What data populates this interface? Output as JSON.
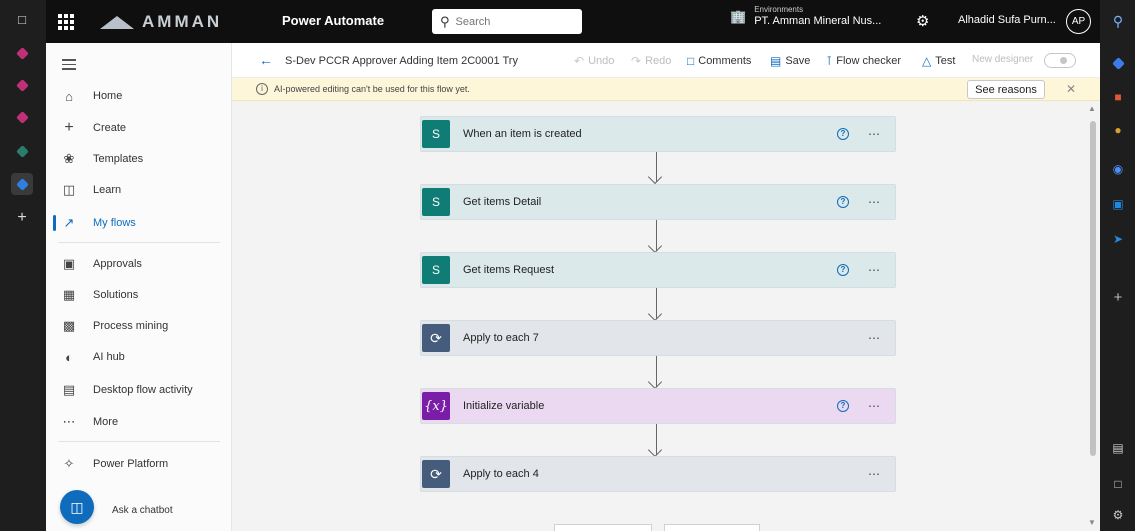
{
  "header": {
    "brand": "AMMAN",
    "app_title": "Power Automate",
    "search_placeholder": "Search",
    "env_label": "Environments",
    "env_name": "PT. Amman Mineral Nus...",
    "user_name": "Alhadid Sufa Purn...",
    "user_initials": "AP"
  },
  "sidebar": {
    "items": [
      {
        "label": "Home",
        "icon": "home-icon"
      },
      {
        "label": "Create",
        "icon": "plus-icon"
      },
      {
        "label": "Templates",
        "icon": "templates-icon"
      },
      {
        "label": "Learn",
        "icon": "book-icon"
      },
      {
        "label": "My flows",
        "icon": "flows-icon",
        "active": true
      },
      {
        "label": "Approvals",
        "icon": "approvals-icon"
      },
      {
        "label": "Solutions",
        "icon": "solutions-icon"
      },
      {
        "label": "Process mining",
        "icon": "process-mining-icon"
      },
      {
        "label": "AI hub",
        "icon": "ai-hub-icon"
      },
      {
        "label": "Desktop flow activity",
        "icon": "desktop-flow-icon"
      },
      {
        "label": "More",
        "icon": "more-icon"
      },
      {
        "label": "Power Platform",
        "icon": "power-platform-icon"
      }
    ],
    "chatbot_label": "Ask a chatbot"
  },
  "toolbar": {
    "flow_title": "S-Dev PCCR Approver Adding Item 2C0001 Try",
    "undo": "Undo",
    "redo": "Redo",
    "comments": "Comments",
    "save": "Save",
    "flow_checker": "Flow checker",
    "test": "Test",
    "new_designer": "New designer"
  },
  "banner": {
    "message": "AI-powered editing can't be used for this flow yet.",
    "see_reasons": "See reasons"
  },
  "flow": {
    "steps": [
      {
        "title": "When an item is created",
        "kind": "sharepoint",
        "help": true
      },
      {
        "title": "Get items Detail",
        "kind": "sharepoint",
        "help": true
      },
      {
        "title": "Get items Request",
        "kind": "sharepoint",
        "help": true
      },
      {
        "title": "Apply to each 7",
        "kind": "control",
        "help": false
      },
      {
        "title": "Initialize variable",
        "kind": "variable",
        "help": true
      },
      {
        "title": "Apply to each 4",
        "kind": "control",
        "help": false
      }
    ]
  },
  "colors": {
    "accent": "#0f6cbd",
    "sharepoint": "#107c76",
    "control": "#465c7c",
    "variable": "#7a1ea8",
    "banner_bg": "#fdf6d8"
  }
}
